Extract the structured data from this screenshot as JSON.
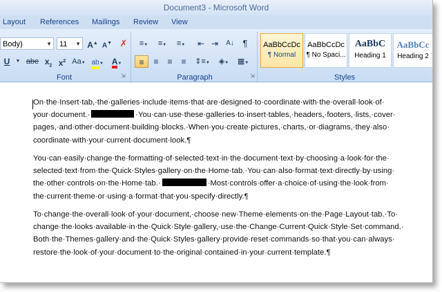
{
  "window": {
    "title": "Document3 - Microsoft Word"
  },
  "tabs": [
    "Layout",
    "References",
    "Mailings",
    "Review",
    "View"
  ],
  "ribbon": {
    "font": {
      "name": "Body)",
      "size": "11",
      "grow_label": "A",
      "shrink_label": "A",
      "underline": "U",
      "strike": "abe",
      "subscript": "x",
      "superscript": "x",
      "change_case": "Aa",
      "font_color": "A",
      "group_label": "Font"
    },
    "paragraph": {
      "group_label": "Paragraph",
      "pilcrow": "¶"
    },
    "styles": {
      "group_label": "Styles",
      "items": [
        {
          "sample": "AaBbCcDc",
          "name": "¶ Normal"
        },
        {
          "sample": "AaBbCcDc",
          "name": "¶ No Spaci..."
        },
        {
          "sample": "AaBbC",
          "name": "Heading 1"
        },
        {
          "sample": "AaBbCc",
          "name": "Heading 2"
        }
      ]
    }
  },
  "document": {
    "paragraphs": [
      {
        "lines": [
          "On·the·Insert·tab,·the·galleries·include·items·that·are·designed·to·coordinate·with·the·overall·look·of·",
          [
            "your·document.·",
            "·You·can·use·these·galleries·to·insert·tables,·headers,·footers,·lists,·cover·"
          ],
          "pages,·and·other·document·building·blocks.·When·you·create·pictures,·charts,·or·diagrams,·they·also·",
          "coordinate·with·your·current·document·look.¶"
        ]
      },
      {
        "lines": [
          "You·can·easily·change·the·formatting·of·selected·text·in·the·document·text·by·choosing·a·look·for·the·",
          "selected·text·from·the·Quick·Styles·gallery·on·the·Home·tab.·You·can·also·format·text·directly·by·using·",
          [
            "the·other·controls·on·the·Home·tab.·",
            "·Most·controls·offer·a·choice·of·using·the·look·from·"
          ],
          "the·current·theme·or·using·a·format·that·you·specify·directly.¶"
        ]
      },
      {
        "lines": [
          "To·change·the·overall·look·of·your·document,·choose·new·Theme·elements·on·the·Page·Layout·tab.·To·",
          "change·the·looks·available·in·the·Quick·Style·gallery,·use·the·Change·Current·Quick·Style·Set·command.·",
          "Both·the·Themes·gallery·and·the·Quick·Styles·gallery·provide·reset·commands·so·that·you·can·always·",
          "restore·the·look·of·your·document·to·the·original·contained·in·your·current·template.¶"
        ]
      }
    ]
  }
}
